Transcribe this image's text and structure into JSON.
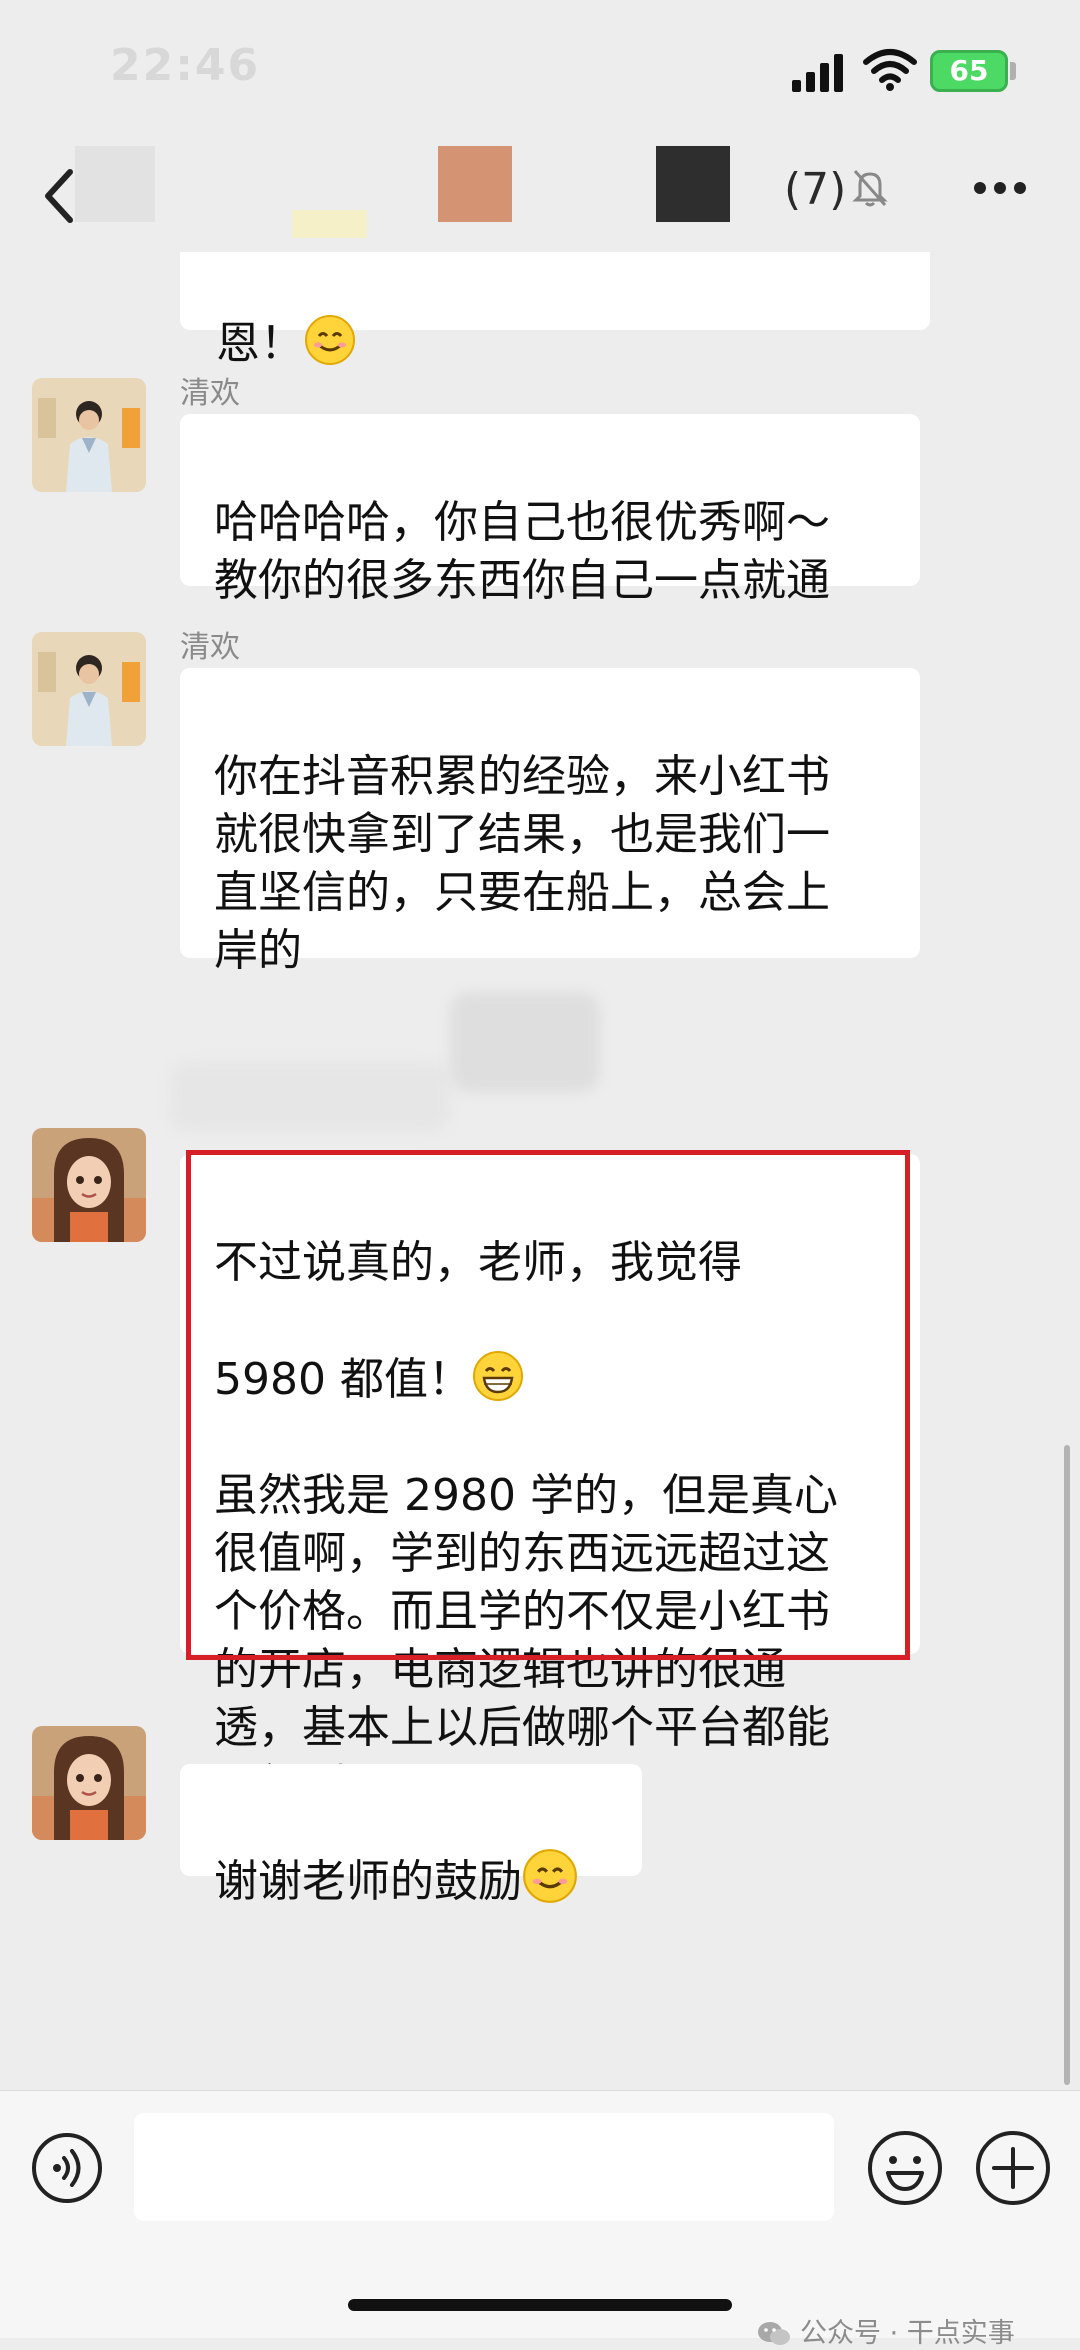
{
  "status_bar": {
    "time": "22:46",
    "battery": "65"
  },
  "nav": {
    "member_count": "(7)"
  },
  "messages": [
    {
      "sender": "",
      "text": "恩！"
    },
    {
      "sender": "清欢",
      "text": "哈哈哈哈，你自己也很优秀啊～\n教你的很多东西你自己一点就通"
    },
    {
      "sender": "清欢",
      "text": "你在抖音积累的经验，来小红书\n就很快拿到了结果，也是我们一\n直坚信的，只要在船上，总会上\n岸的"
    },
    {
      "sender": "",
      "text_line1": "不过说真的，老师，我觉得",
      "text_line2": "5980 都值！",
      "text_rest": "虽然我是 2980 学的，但是真心\n很值啊，学到的东西远远超过这\n个价格。而且学的不仅是小红书\n的开店，电商逻辑也讲的很通\n透，基本上以后做哪个平台都能\n用得到～"
    },
    {
      "sender": "",
      "text": "谢谢老师的鼓励"
    }
  ],
  "input": {
    "placeholder": ""
  },
  "watermark": "公众号 · 干点实事",
  "colors": {
    "background": "#ededed",
    "bubble": "#ffffff",
    "highlight": "#d61f26",
    "battery": "#4cd964"
  },
  "icons": {
    "back": "chevron-left-icon",
    "mute": "bell-off-icon",
    "more": "ellipsis-icon",
    "voice": "voice-icon",
    "emoji": "smile-icon",
    "plus": "plus-icon"
  }
}
